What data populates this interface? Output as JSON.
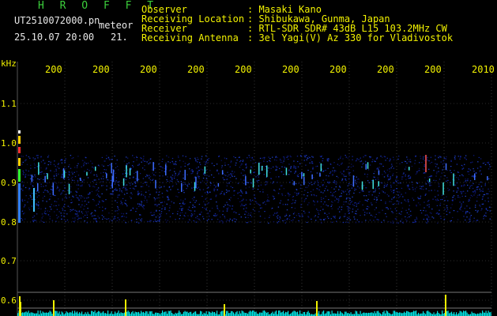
{
  "header": {
    "station": "H R O F F T",
    "filename": "UT2510072000.pn",
    "mode": "meteor",
    "datetime": "25.10.07 20:00",
    "count": "21."
  },
  "info": [
    {
      "label": "Observer",
      "value": ": Masaki Kano"
    },
    {
      "label": "Receiving Location",
      "value": ": Shibukawa, Gunma, Japan"
    },
    {
      "label": "Receiver",
      "value": ": RTL-SDR SDR# 43dB L15 103.2MHz CW"
    },
    {
      "label": "Receiving Antenna",
      "value": ": 3el Yagi(V) Az 330 for Vladivostok"
    }
  ],
  "spectrogram": {
    "ylabel_unit": "kHz",
    "y_ticks": [
      "1.1",
      "1.0",
      "0.9",
      "0.8",
      "0.7",
      "0.6"
    ],
    "x_ticks": [
      "200",
      "200",
      "200",
      "200",
      "200",
      "200",
      "200",
      "200",
      "200",
      "2010"
    ]
  },
  "colors": {
    "background": "#000000",
    "text": "#f2f200",
    "title": "#3ccf3c",
    "grid": "#3a3a3a",
    "baseline": "#00ffff"
  }
}
